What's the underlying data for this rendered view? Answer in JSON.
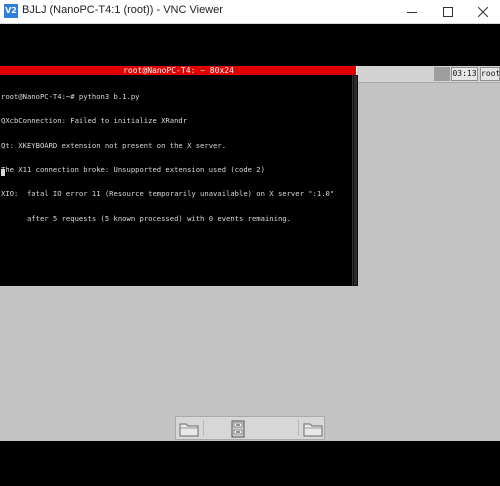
{
  "window": {
    "app_icon_label": "V2",
    "title": "BJLJ (NanoPC-T4:1 (root)) - VNC Viewer"
  },
  "terminal": {
    "title": "root@NanoPC-T4: ~ 80x24",
    "lines": [
      "root@NanoPC-T4:~# python3 b.1.py",
      "QXcbConnection: Failed to initialize XRandr",
      "Qt: XKEYBOARD extension not present on the X server.",
      "The X11 connection broke: Unsupported extension used (code 2)",
      "XIO:  fatal IO error 11 (Resource temporarily unavailable) on X server \":1.0\"",
      "      after 5 requests (5 known processed) with 0 events remaining."
    ]
  },
  "panel": {
    "clock": "03:13",
    "user": "root"
  },
  "dock": {
    "items": [
      "folder-icon",
      "file-cabinet-icon",
      "folder-icon"
    ]
  },
  "colors": {
    "terminal_title_bar": "#e00000",
    "desktop": "#c3c3c3",
    "remote_background": "#000000"
  }
}
